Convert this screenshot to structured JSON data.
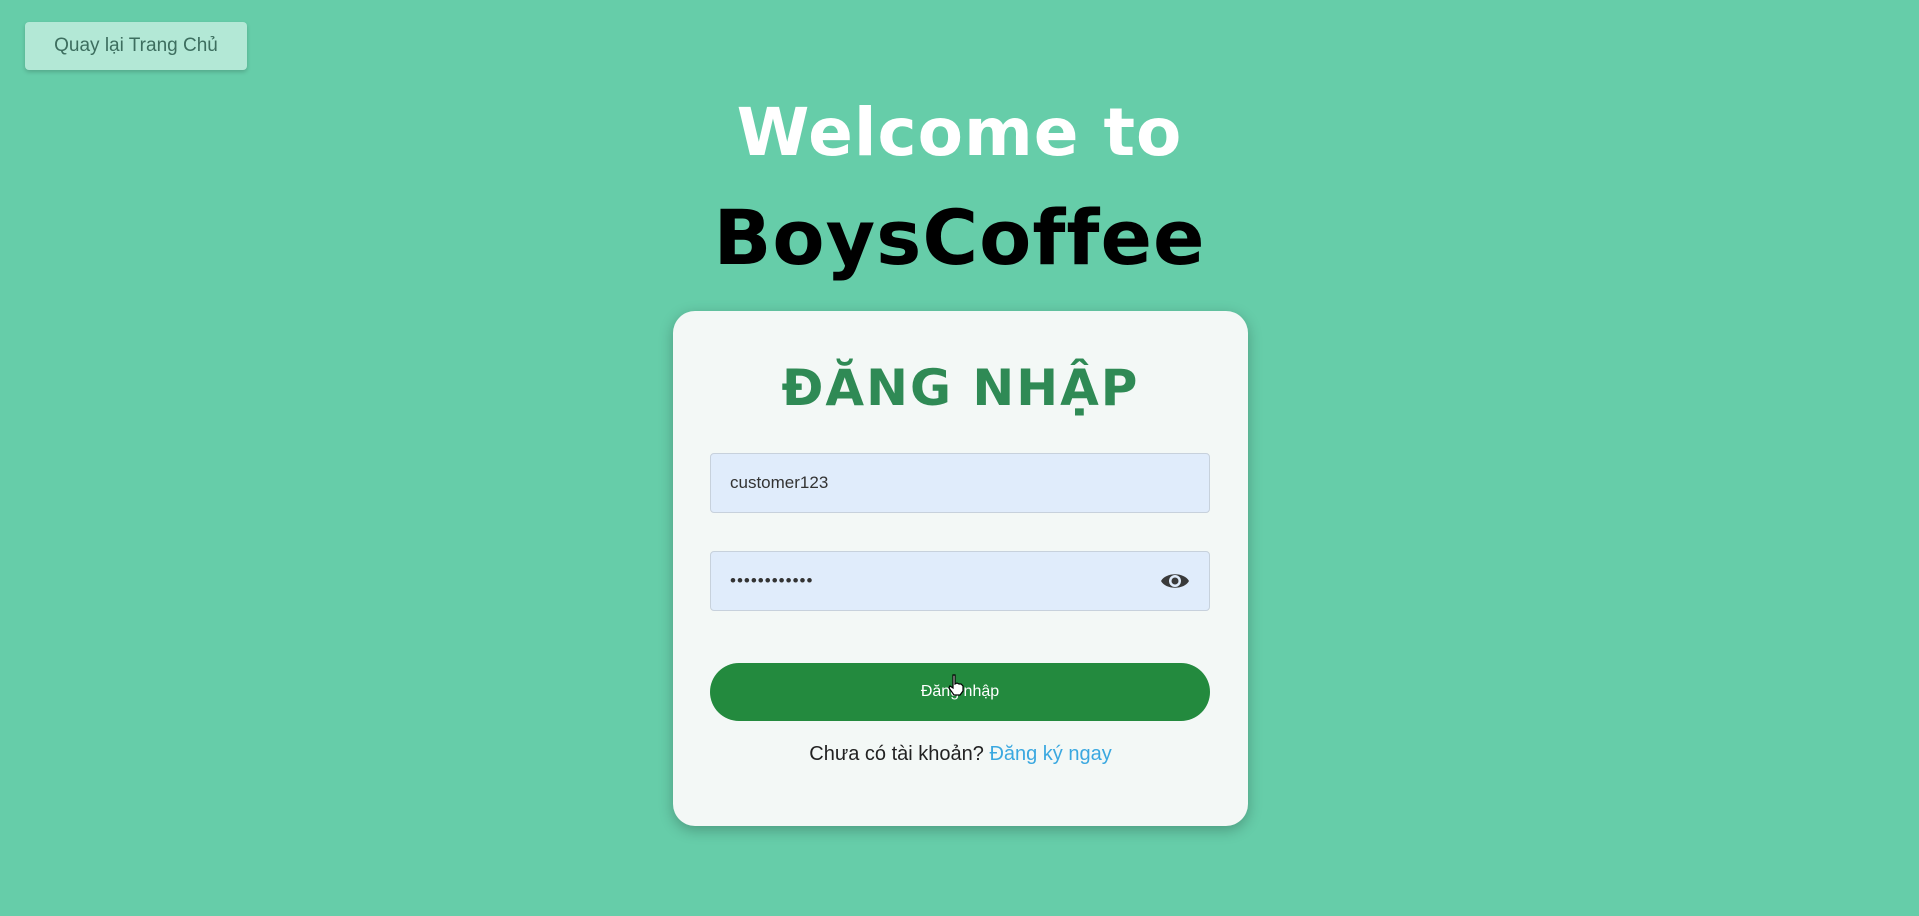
{
  "back_button": {
    "label": "Quay lại Trang Chủ"
  },
  "hero": {
    "welcome": "Welcome to",
    "brand": "BoysCoffee"
  },
  "login": {
    "title": "ĐĂNG NHẬP",
    "username_value": "customer123",
    "password_value": "••••••••••••",
    "show_password_icon": "eye-icon",
    "submit_label": "Đăng nhập",
    "signup_prompt": "Chưa có tài khoản?",
    "signup_link": "Đăng ký ngay"
  },
  "colors": {
    "background": "#66cda9",
    "card": "#f3f8f6",
    "title": "#2f8a55",
    "submit": "#238a3e",
    "link": "#3aa8e0",
    "input_bg": "#e0ecfb"
  }
}
